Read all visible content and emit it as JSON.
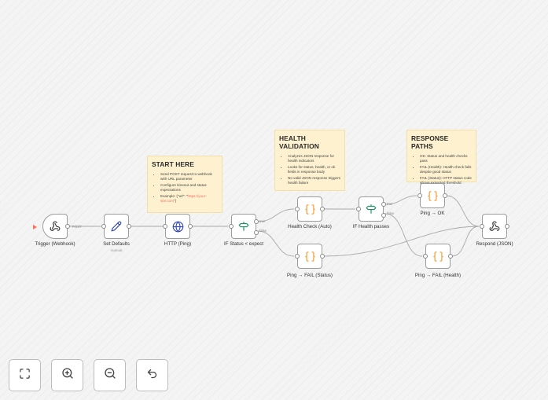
{
  "colors": {
    "canvas": "#f4f4f4",
    "sticky": "#fdf1cf",
    "accent": "#ff6d5a",
    "code_icon": "#f7a13b",
    "http_icon": "#3347b6",
    "pen_icon": "#3347b6",
    "if_icon": "#1e8f61"
  },
  "nodes": {
    "trigger": {
      "label": "Trigger (Webhook)",
      "icon": "webhook-icon"
    },
    "set_defaults": {
      "label": "Set Defaults",
      "sub": "manual",
      "icon": "pencil-icon"
    },
    "http": {
      "label": "HTTP (Ping)",
      "icon": "globe-icon"
    },
    "if_status": {
      "label": "IF Status < expect",
      "icon": "signpost-icon"
    },
    "health_check": {
      "label": "Health Check (Auto)",
      "icon": "code-braces-icon"
    },
    "if_health": {
      "label": "IF Health passes",
      "icon": "signpost-icon"
    },
    "ping_ok": {
      "label": "Ping → OK",
      "icon": "code-braces-icon"
    },
    "ping_fail_status": {
      "label": "Ping → FAIL (Status)",
      "icon": "code-braces-icon"
    },
    "ping_fail_health": {
      "label": "Ping → FAIL (Health)",
      "icon": "code-braces-icon"
    },
    "respond": {
      "label": "Respond (JSON)",
      "icon": "webhook-icon"
    }
  },
  "edge_labels": {
    "post": "POST",
    "status_true": "true",
    "status_false": "false",
    "health_true": "true",
    "health_false": "false"
  },
  "stickies": {
    "start": {
      "title": "START HERE",
      "items": [
        "Send POST request to webhook with URL parameter",
        "Configure timeout and status expectations"
      ],
      "example_prefix": "Example: {\"url\": \"",
      "example_url": "https://your-site.com",
      "example_suffix": "\"}"
    },
    "health": {
      "title": "HEALTH VALIDATION",
      "items": [
        "Analyzes JSON response for health indicators",
        "Looks for status, health, or ok fields in response body",
        "No valid JSON response triggers health failure"
      ]
    },
    "response": {
      "title": "RESPONSE PATHS",
      "items": [
        "OK: Status and health checks pass",
        "FAIL (Health): Health check fails despite good status",
        "FAIL (Status): HTTP status code above expected threshold"
      ]
    }
  },
  "controls": [
    {
      "name": "fit-view-button",
      "icon": "fit-view-icon"
    },
    {
      "name": "zoom-in-button",
      "icon": "zoom-in-icon"
    },
    {
      "name": "zoom-out-button",
      "icon": "zoom-out-icon"
    },
    {
      "name": "undo-button",
      "icon": "undo-icon"
    }
  ]
}
